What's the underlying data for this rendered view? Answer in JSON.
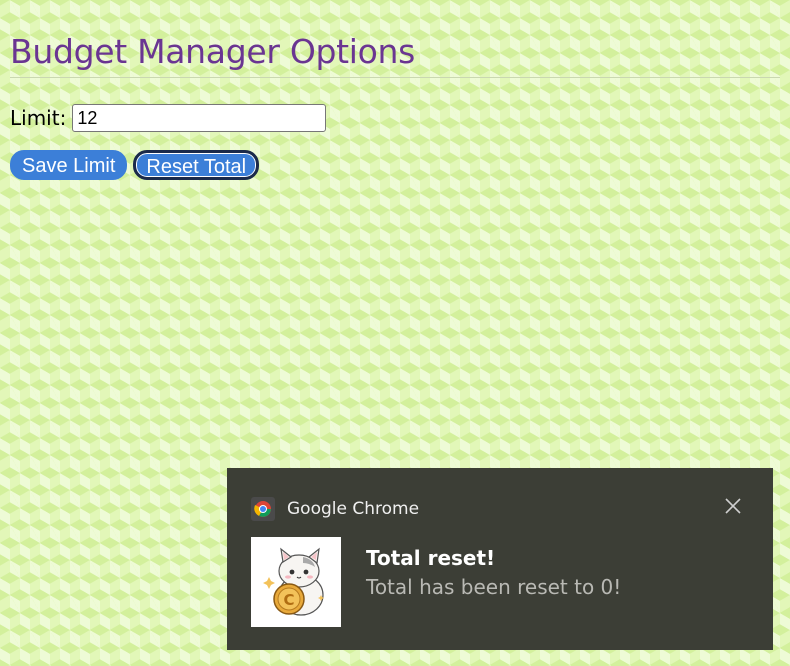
{
  "page": {
    "title": "Budget Manager Options"
  },
  "limit": {
    "label": "Limit:",
    "value": "12"
  },
  "buttons": {
    "save_label": "Save Limit",
    "reset_label": "Reset Total"
  },
  "notification": {
    "app_name": "Google Chrome",
    "app_icon": "chrome-icon",
    "close_icon": "close-icon",
    "image_icon": "cat-with-coin-icon",
    "title": "Total reset!",
    "message": "Total has been reset to 0!"
  },
  "colors": {
    "title": "#6a3592",
    "button": "#3c7fd8",
    "toast_background": "#3c3e36",
    "background": "#e2f7b8"
  }
}
